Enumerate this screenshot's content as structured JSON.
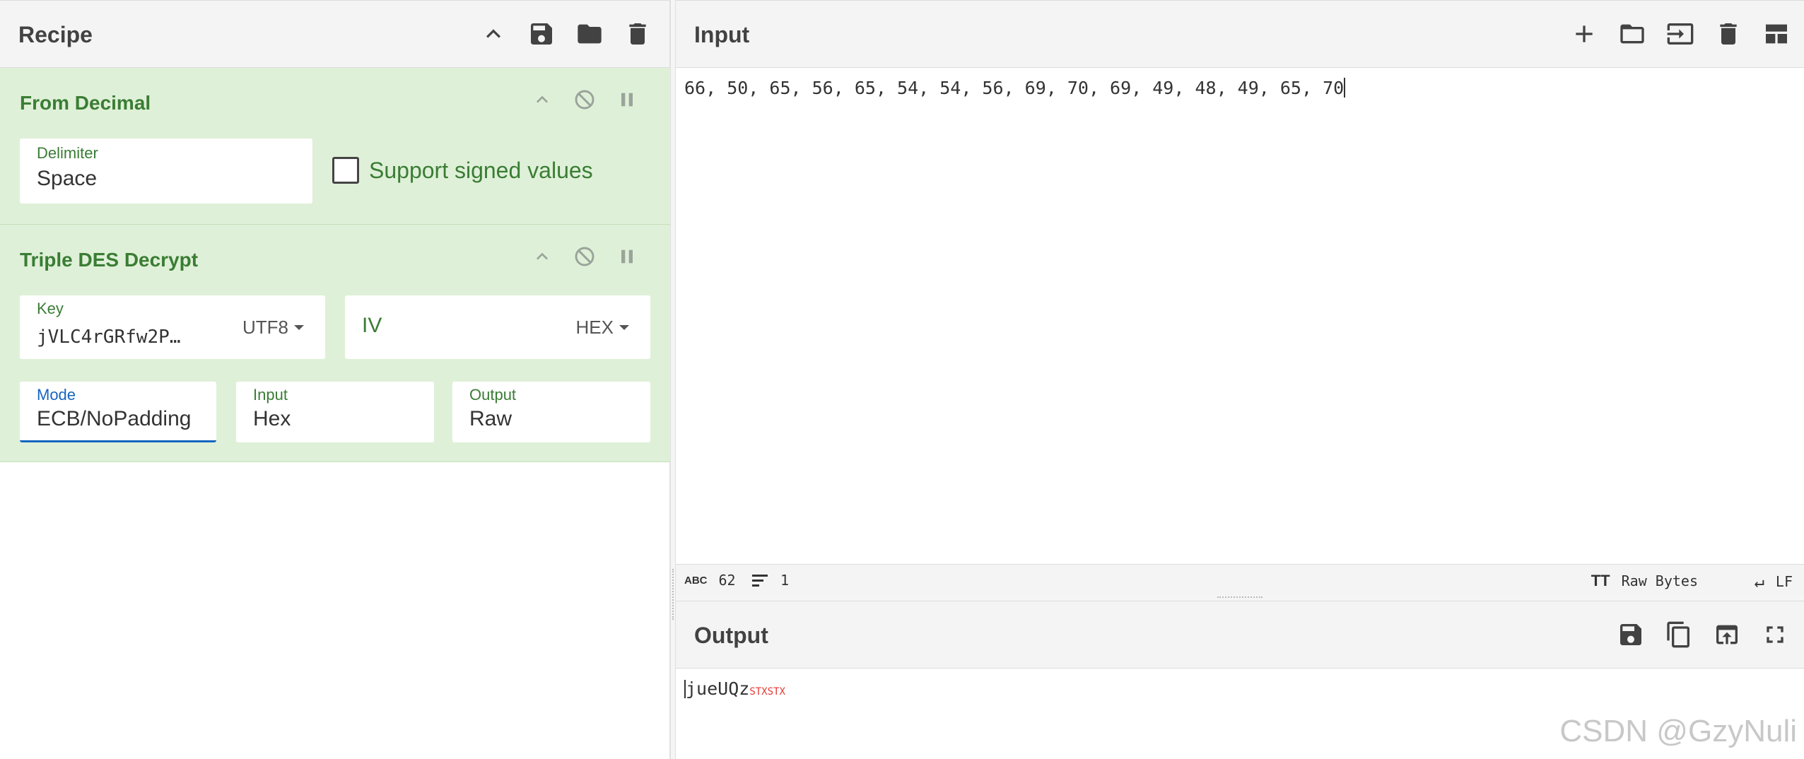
{
  "recipe": {
    "title": "Recipe",
    "icons": [
      "chevron-up-icon",
      "save-icon",
      "folder-icon",
      "trash-icon"
    ]
  },
  "operations": {
    "from_decimal": {
      "title": "From Decimal",
      "delimiter_label": "Delimiter",
      "delimiter_value": "Space",
      "signed_label": "Support signed values",
      "signed_checked": false
    },
    "triple_des": {
      "title": "Triple DES Decrypt",
      "key_label": "Key",
      "key_value": "jVLC4rGRfw2P…",
      "key_encoding": "UTF8",
      "iv_label": "IV",
      "iv_encoding": "HEX",
      "mode_label": "Mode",
      "mode_value": "ECB/NoPadding",
      "input_label": "Input",
      "input_value": "Hex",
      "output_label": "Output",
      "output_value": "Raw"
    }
  },
  "input": {
    "title": "Input",
    "text": "66, 50, 65, 56, 65, 54, 54, 56, 69, 70, 69, 49, 48, 49, 65, 70",
    "icons": [
      "plus-icon",
      "folder-icon",
      "import-icon",
      "trash-icon",
      "layout-icon"
    ]
  },
  "status": {
    "abc_icon": "ABC",
    "char_count": "62",
    "line_count": "1",
    "encoding_icon": "TT",
    "encoding": "Raw Bytes",
    "eol": "LF"
  },
  "output": {
    "title": "Output",
    "text": "jueUQz",
    "control_chars": "STXSTX",
    "icons": [
      "save-icon",
      "copy-icon",
      "replace-input-icon",
      "fullscreen-icon"
    ]
  },
  "watermark": "CSDN @GzyNuli",
  "colors": {
    "op_background": "#dff0d8",
    "op_title": "#3a7d34",
    "focus_blue": "#1565c0",
    "control_char_red": "#e53935"
  }
}
